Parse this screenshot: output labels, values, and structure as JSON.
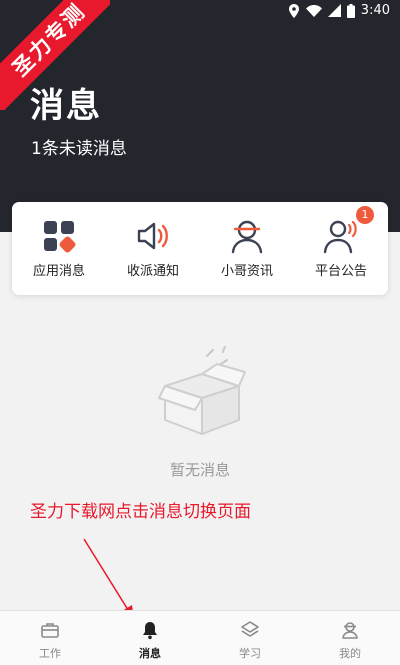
{
  "status_bar": {
    "time": "3:40"
  },
  "watermark": {
    "text": "圣力专测"
  },
  "page": {
    "title": "消息",
    "unread_text": "1条未读消息"
  },
  "categories": [
    {
      "label": "应用消息",
      "icon": "app-grid-icon"
    },
    {
      "label": "收派通知",
      "icon": "speaker-icon"
    },
    {
      "label": "小哥资讯",
      "icon": "courier-icon"
    },
    {
      "label": "平台公告",
      "icon": "announcer-icon",
      "badge": "1"
    }
  ],
  "empty_state": {
    "text": "暂无消息",
    "icon": "empty-box-icon"
  },
  "annotation": {
    "text": "圣力下载网点击消息切换页面"
  },
  "bottom_nav": [
    {
      "label": "工作",
      "icon": "toolbox-icon",
      "active": false
    },
    {
      "label": "消息",
      "icon": "bell-icon",
      "active": true
    },
    {
      "label": "学习",
      "icon": "layers-icon",
      "active": false
    },
    {
      "label": "我的",
      "icon": "profile-icon",
      "active": false
    }
  ],
  "colors": {
    "header_bg": "#24262d",
    "accent": "#f05a3c",
    "annotation": "#e8192c"
  }
}
